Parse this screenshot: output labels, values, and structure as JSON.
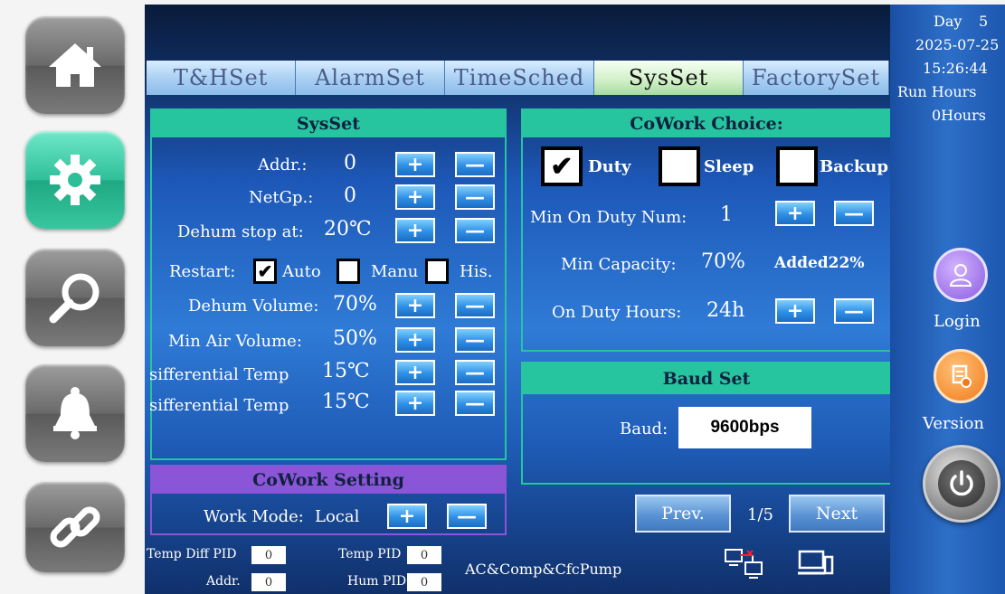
{
  "tabs": [
    {
      "label": "T&HSet"
    },
    {
      "label": "AlarmSet"
    },
    {
      "label": "TimeSched"
    },
    {
      "label": "SysSet"
    },
    {
      "label": "FactorySet"
    }
  ],
  "status": {
    "day_label": "Day",
    "day_value": "5",
    "date": "2025-07-25",
    "time": "15:26:44",
    "run_hours_label": "Run Hours",
    "run_hours_value": "0Hours",
    "login_label": "Login",
    "version_label": "Version"
  },
  "sysset": {
    "title": "SysSet",
    "addr_label": "Addr.:",
    "addr_value": "0",
    "netgp_label": "NetGp.:",
    "netgp_value": "0",
    "dehum_stop_label": "Dehum stop at:",
    "dehum_stop_value": "20℃",
    "restart_label": "Restart:",
    "restart_auto": "Auto",
    "restart_manu": "Manu",
    "restart_his": "His.",
    "dehum_volume_label": "Dehum Volume:",
    "dehum_volume_value": "70%",
    "min_air_label": "Min Air Volume:",
    "min_air_value": "50%",
    "diff_temp1_label": "sifferential Temp",
    "diff_temp1_value": "15℃",
    "diff_temp2_label": "sifferential Temp",
    "diff_temp2_value": "15℃",
    "plus": "+",
    "minus": "—",
    "check": "✔"
  },
  "cowork_setting": {
    "title": "CoWork Setting",
    "work_mode_label": "Work Mode:",
    "work_mode_value": "Local"
  },
  "cowork_choice": {
    "title": "CoWork Choice:",
    "duty_label": "Duty",
    "sleep_label": "Sleep",
    "backup_label": "Backup",
    "min_on_duty_label": "Min On Duty Num:",
    "min_on_duty_value": "1",
    "min_capacity_label": "Min Capacity:",
    "min_capacity_value": "70%",
    "added_label": "Added22%",
    "on_duty_hours_label": "On Duty Hours:",
    "on_duty_hours_value": "24h"
  },
  "baud": {
    "title": "Baud Set",
    "label": "Baud:",
    "value": "9600bps"
  },
  "pager": {
    "prev": "Prev.",
    "page": "1/5",
    "next": "Next"
  },
  "bottom": {
    "temp_diff_pid_label": "Temp Diff PID",
    "temp_diff_pid_value": "0",
    "temp_pid_label": "Temp PID",
    "temp_pid_value": "0",
    "addr_label": "Addr.",
    "addr_value": "0",
    "hum_pid_label": "Hum PID",
    "hum_pid_value": "0",
    "device_text": "AC&Comp&CfcPump"
  },
  "colors": {
    "accent_green": "#27c4a0",
    "purple_header": "#8a55d6",
    "nav_active": "#2fbf98"
  }
}
